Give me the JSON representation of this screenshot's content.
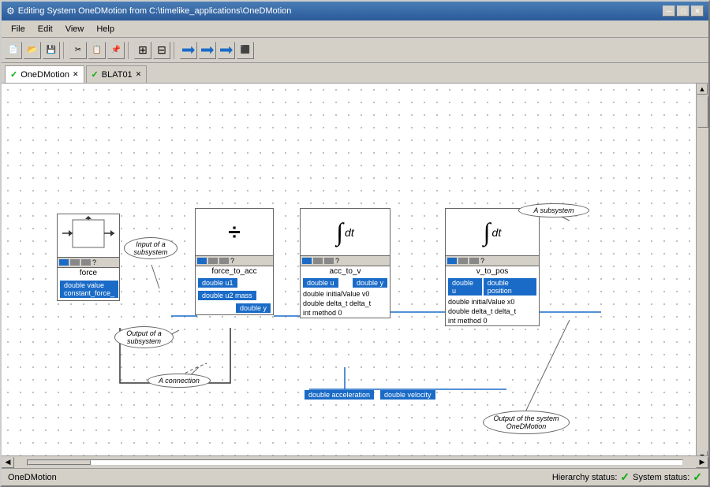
{
  "window": {
    "title": "Editing System OneDMotion from C:\\timelike_applications\\OneDMotion",
    "titleIcon": "⚙"
  },
  "titleButtons": {
    "minimize": "─",
    "maximize": "□",
    "close": "✕"
  },
  "menu": {
    "items": [
      "File",
      "Edit",
      "View",
      "Help"
    ]
  },
  "tabs": [
    {
      "id": "OneDMotion",
      "label": "OneDMotion",
      "active": true,
      "hasCheck": true
    },
    {
      "id": "BLAT01",
      "label": "BLAT01",
      "active": false,
      "hasCheck": true
    }
  ],
  "blocks": {
    "force": {
      "name": "force",
      "port_out": "double value constant_force_"
    },
    "div": {
      "name": "force_to_acc",
      "port_in1": "double u1",
      "port_in2": "double u2 mass",
      "port_out": "double y"
    },
    "int1": {
      "name": "acc_to_v",
      "port_in": "double u",
      "port_out": "double y",
      "param1": "double  initialValue  v0",
      "param2": "double  delta_t     delta_t",
      "param3": "int     method      0",
      "port_bottom": "double acceleration"
    },
    "int2": {
      "name": "v_to_pos",
      "port_in": "double u",
      "port_out": "double position",
      "param1": "double  initialValue  x0",
      "param2": "double  delta_t     delta_t",
      "param3": "int     method      0",
      "port_bottom": "double velocity"
    }
  },
  "callouts": {
    "inputSubsystem": "Input of a\nsubsystem",
    "outputSubsystem": "Output of a\nsubsystem",
    "aSubsystem": "A subsystem",
    "aConnection": "A connection",
    "outputSystem": "Output of the system\nOneDMotion"
  },
  "statusBar": {
    "systemName": "OneDMotion",
    "hierarchyLabel": "Hierarchy status:",
    "systemLabel": "System status:"
  }
}
